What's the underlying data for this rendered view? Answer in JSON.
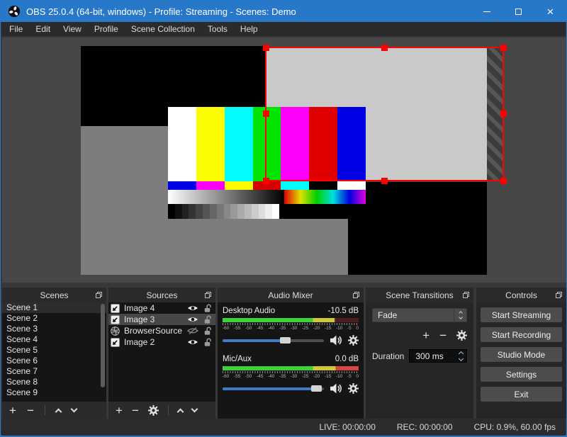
{
  "window": {
    "title": "OBS 25.0.4 (64-bit, windows) - Profile: Streaming - Scenes: Demo"
  },
  "colors": {
    "titlebar_blue": "#2878ca",
    "selection_red": "#ff0000",
    "slider_blue": "#3b7cc4",
    "meter_green": "#3bd23b",
    "meter_yellow": "#cfc93a",
    "meter_red": "#dc4343"
  },
  "menu": {
    "items": [
      "File",
      "Edit",
      "View",
      "Profile",
      "Scene Collection",
      "Tools",
      "Help"
    ]
  },
  "preview": {
    "test_pattern": {
      "bars": [
        "#ffffff",
        "#fcfc00",
        "#00fcfc",
        "#00e400",
        "#fc00fc",
        "#e00000",
        "#0000e4"
      ],
      "row2": [
        "#0000e4",
        "#fc00fc",
        "#fcfc00",
        "#d80000",
        "#00fcfc",
        "#000000",
        "#ffffff"
      ],
      "gray_steps": 16
    }
  },
  "panels": {
    "scenes": {
      "title": "Scenes",
      "items": [
        "Scene 1",
        "Scene 2",
        "Scene 3",
        "Scene 4",
        "Scene 5",
        "Scene 6",
        "Scene 7",
        "Scene 8",
        "Scene 9"
      ],
      "selected_index": 0
    },
    "sources": {
      "title": "Sources",
      "rows": [
        {
          "name": "Image 4",
          "icon": "image",
          "visible": true,
          "locked": false,
          "selected": false
        },
        {
          "name": "Image 3",
          "icon": "image",
          "visible": true,
          "locked": false,
          "selected": true
        },
        {
          "name": "BrowserSource",
          "icon": "globe",
          "visible": false,
          "locked": false,
          "selected": false
        },
        {
          "name": "Image 2",
          "icon": "image",
          "visible": true,
          "locked": false,
          "selected": false
        }
      ]
    },
    "mixer": {
      "title": "Audio Mixer",
      "tick_labels": [
        "-60",
        "-55",
        "-50",
        "-45",
        "-40",
        "-35",
        "-30",
        "-25",
        "-20",
        "-15",
        "-10",
        "-5",
        "0"
      ],
      "channels": [
        {
          "name": "Desktop Audio",
          "db": "-10.5 dB",
          "level_pct": 82.5,
          "slider_pct": 62
        },
        {
          "name": "Mic/Aux",
          "db": "0.0 dB",
          "level_pct": 100,
          "slider_pct": 93
        }
      ]
    },
    "transitions": {
      "title": "Scene Transitions",
      "combo_value": "Fade",
      "duration_label": "Duration",
      "duration_value": "300 ms"
    },
    "controls": {
      "title": "Controls",
      "buttons": [
        "Start Streaming",
        "Start Recording",
        "Studio Mode",
        "Settings",
        "Exit"
      ]
    }
  },
  "statusbar": {
    "live": "LIVE: 00:00:00",
    "rec": "REC: 00:00:00",
    "cpu": "CPU: 0.9%, 60.00 fps"
  }
}
